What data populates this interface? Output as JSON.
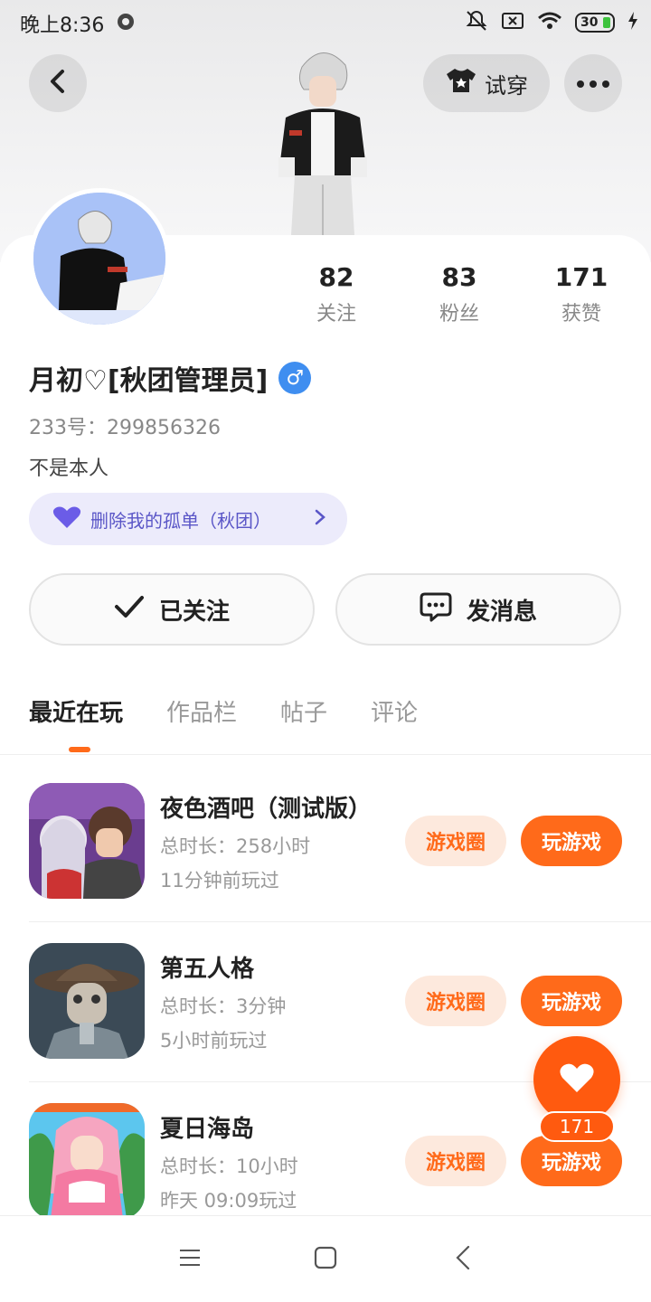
{
  "status_bar": {
    "time": "晚上8:36",
    "battery": "30"
  },
  "header": {
    "tryon_label": "试穿"
  },
  "profile": {
    "stats": [
      {
        "value": "82",
        "label": "关注"
      },
      {
        "value": "83",
        "label": "粉丝"
      },
      {
        "value": "171",
        "label": "获赞"
      }
    ],
    "username": "月初♡[秋团管理员]",
    "gender_symbol": "♂",
    "uid": "233号：299856326",
    "bio": "不是本人",
    "group_label": "删除我的孤单（秋团）"
  },
  "actions": {
    "follow_label": "已关注",
    "message_label": "发消息"
  },
  "tabs": [
    "最近在玩",
    "作品栏",
    "帖子",
    "评论"
  ],
  "games": [
    {
      "title": "夜色酒吧（测试版）",
      "duration": "总时长：258小时",
      "last_played": "11分钟前玩过",
      "circle_label": "游戏圈",
      "play_label": "玩游戏"
    },
    {
      "title": "第五人格",
      "duration": "总时长：3分钟",
      "last_played": "5小时前玩过",
      "circle_label": "游戏圈",
      "play_label": "玩游戏"
    },
    {
      "title": "夏日海岛",
      "duration": "总时长：10小时",
      "last_played": "昨天 09:09玩过",
      "circle_label": "游戏圈",
      "play_label": "玩游戏"
    }
  ],
  "like_fab": {
    "count": "171"
  },
  "colors": {
    "accent": "#ff6a1a",
    "pill_bg": "#ecebfb",
    "pill_text": "#5a56c7",
    "gender": "#3f8ef0"
  }
}
